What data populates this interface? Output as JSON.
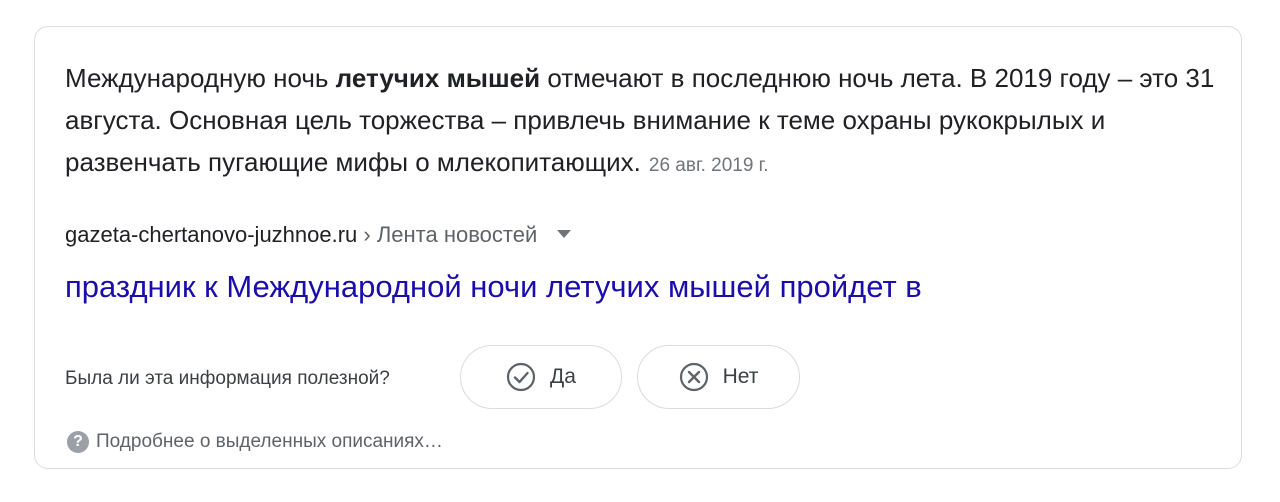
{
  "snippet": {
    "part1": "Международную ночь ",
    "bold": "летучих мышей",
    "part2": " отмечают в последнюю ночь лета. В 2019 году – это 31 августа. Основная цель торжества – привлечь внимание к теме охраны рукокрылых и развенчать пугающие мифы о млекопитающих.",
    "date": "26 авг. 2019 г."
  },
  "source": {
    "domain": "gazeta-chertanovo-juzhnoe.ru",
    "separator": " › ",
    "breadcrumb": "Лента новостей",
    "caret_icon": "dropdown-caret-icon"
  },
  "result": {
    "title": "праздник к Международной ночи летучих мышей пройдет в"
  },
  "feedback": {
    "question": "Была ли эта информация полезной?",
    "yes_label": "Да",
    "no_label": "Нет",
    "yes_icon": "check-circle-icon",
    "no_icon": "x-circle-icon"
  },
  "more": {
    "label": "Подробнее о выделенных описаниях…",
    "icon": "question-circle-icon",
    "icon_glyph": "?"
  },
  "colors": {
    "link": "#1a0dab",
    "text": "#202124",
    "muted": "#70757a",
    "border": "#dadce0"
  }
}
